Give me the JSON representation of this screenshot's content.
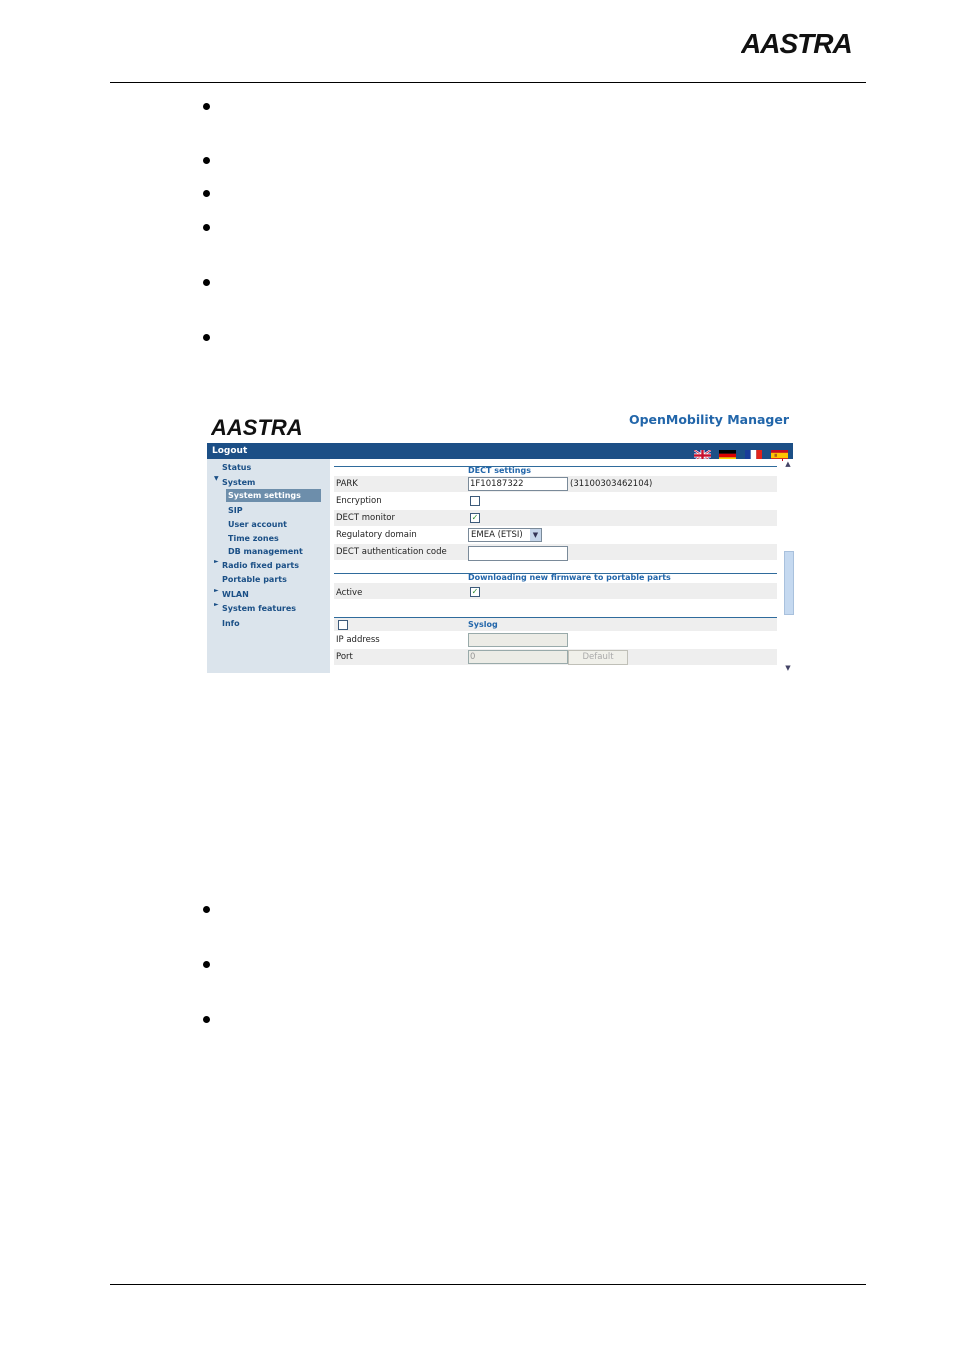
{
  "brand": {
    "logo_text": "AASTRA"
  },
  "app": {
    "logo_text": "AASTRA",
    "title": "OpenMobility Manager",
    "logout_label": "Logout",
    "flags": [
      "uk-flag-icon",
      "de-flag-icon",
      "fr-flag-icon",
      "es-flag-icon"
    ]
  },
  "sidebar": {
    "items": [
      {
        "label": "Status",
        "indent": false,
        "arrow": ""
      },
      {
        "label": "System",
        "indent": false,
        "arrow": "▼"
      },
      {
        "label": "System settings",
        "indent": true,
        "selected": true
      },
      {
        "label": "SIP",
        "indent": true
      },
      {
        "label": "User account",
        "indent": true
      },
      {
        "label": "Time zones",
        "indent": true
      },
      {
        "label": "DB management",
        "indent": true
      },
      {
        "label": "Radio fixed parts",
        "indent": false,
        "arrow": "►"
      },
      {
        "label": "Portable parts",
        "indent": false
      },
      {
        "label": "WLAN",
        "indent": false,
        "arrow": "►"
      },
      {
        "label": "System features",
        "indent": false,
        "arrow": "►"
      },
      {
        "label": "Info",
        "indent": false
      }
    ]
  },
  "dect": {
    "title": "DECT settings",
    "park_label": "PARK",
    "park_value": "1F10187322",
    "park_note": "(31100303462104)",
    "encryption_label": "Encryption",
    "encryption_checked": false,
    "monitor_label": "DECT monitor",
    "monitor_checked": true,
    "domain_label": "Regulatory domain",
    "domain_value": "EMEA (ETSI)",
    "auth_label": "DECT authentication code",
    "auth_value": ""
  },
  "firmware": {
    "title": "Downloading new firmware to portable parts",
    "active_label": "Active",
    "active_checked": true
  },
  "syslog": {
    "title": "Syslog",
    "enabled": false,
    "ip_label": "IP address",
    "ip_value": "",
    "port_label": "Port",
    "port_value": "0",
    "default_label": "Default"
  },
  "colors": {
    "header_bar": "#1c4f86",
    "sidebar_bg": "#dbe4ec",
    "accent": "#2266aa"
  }
}
